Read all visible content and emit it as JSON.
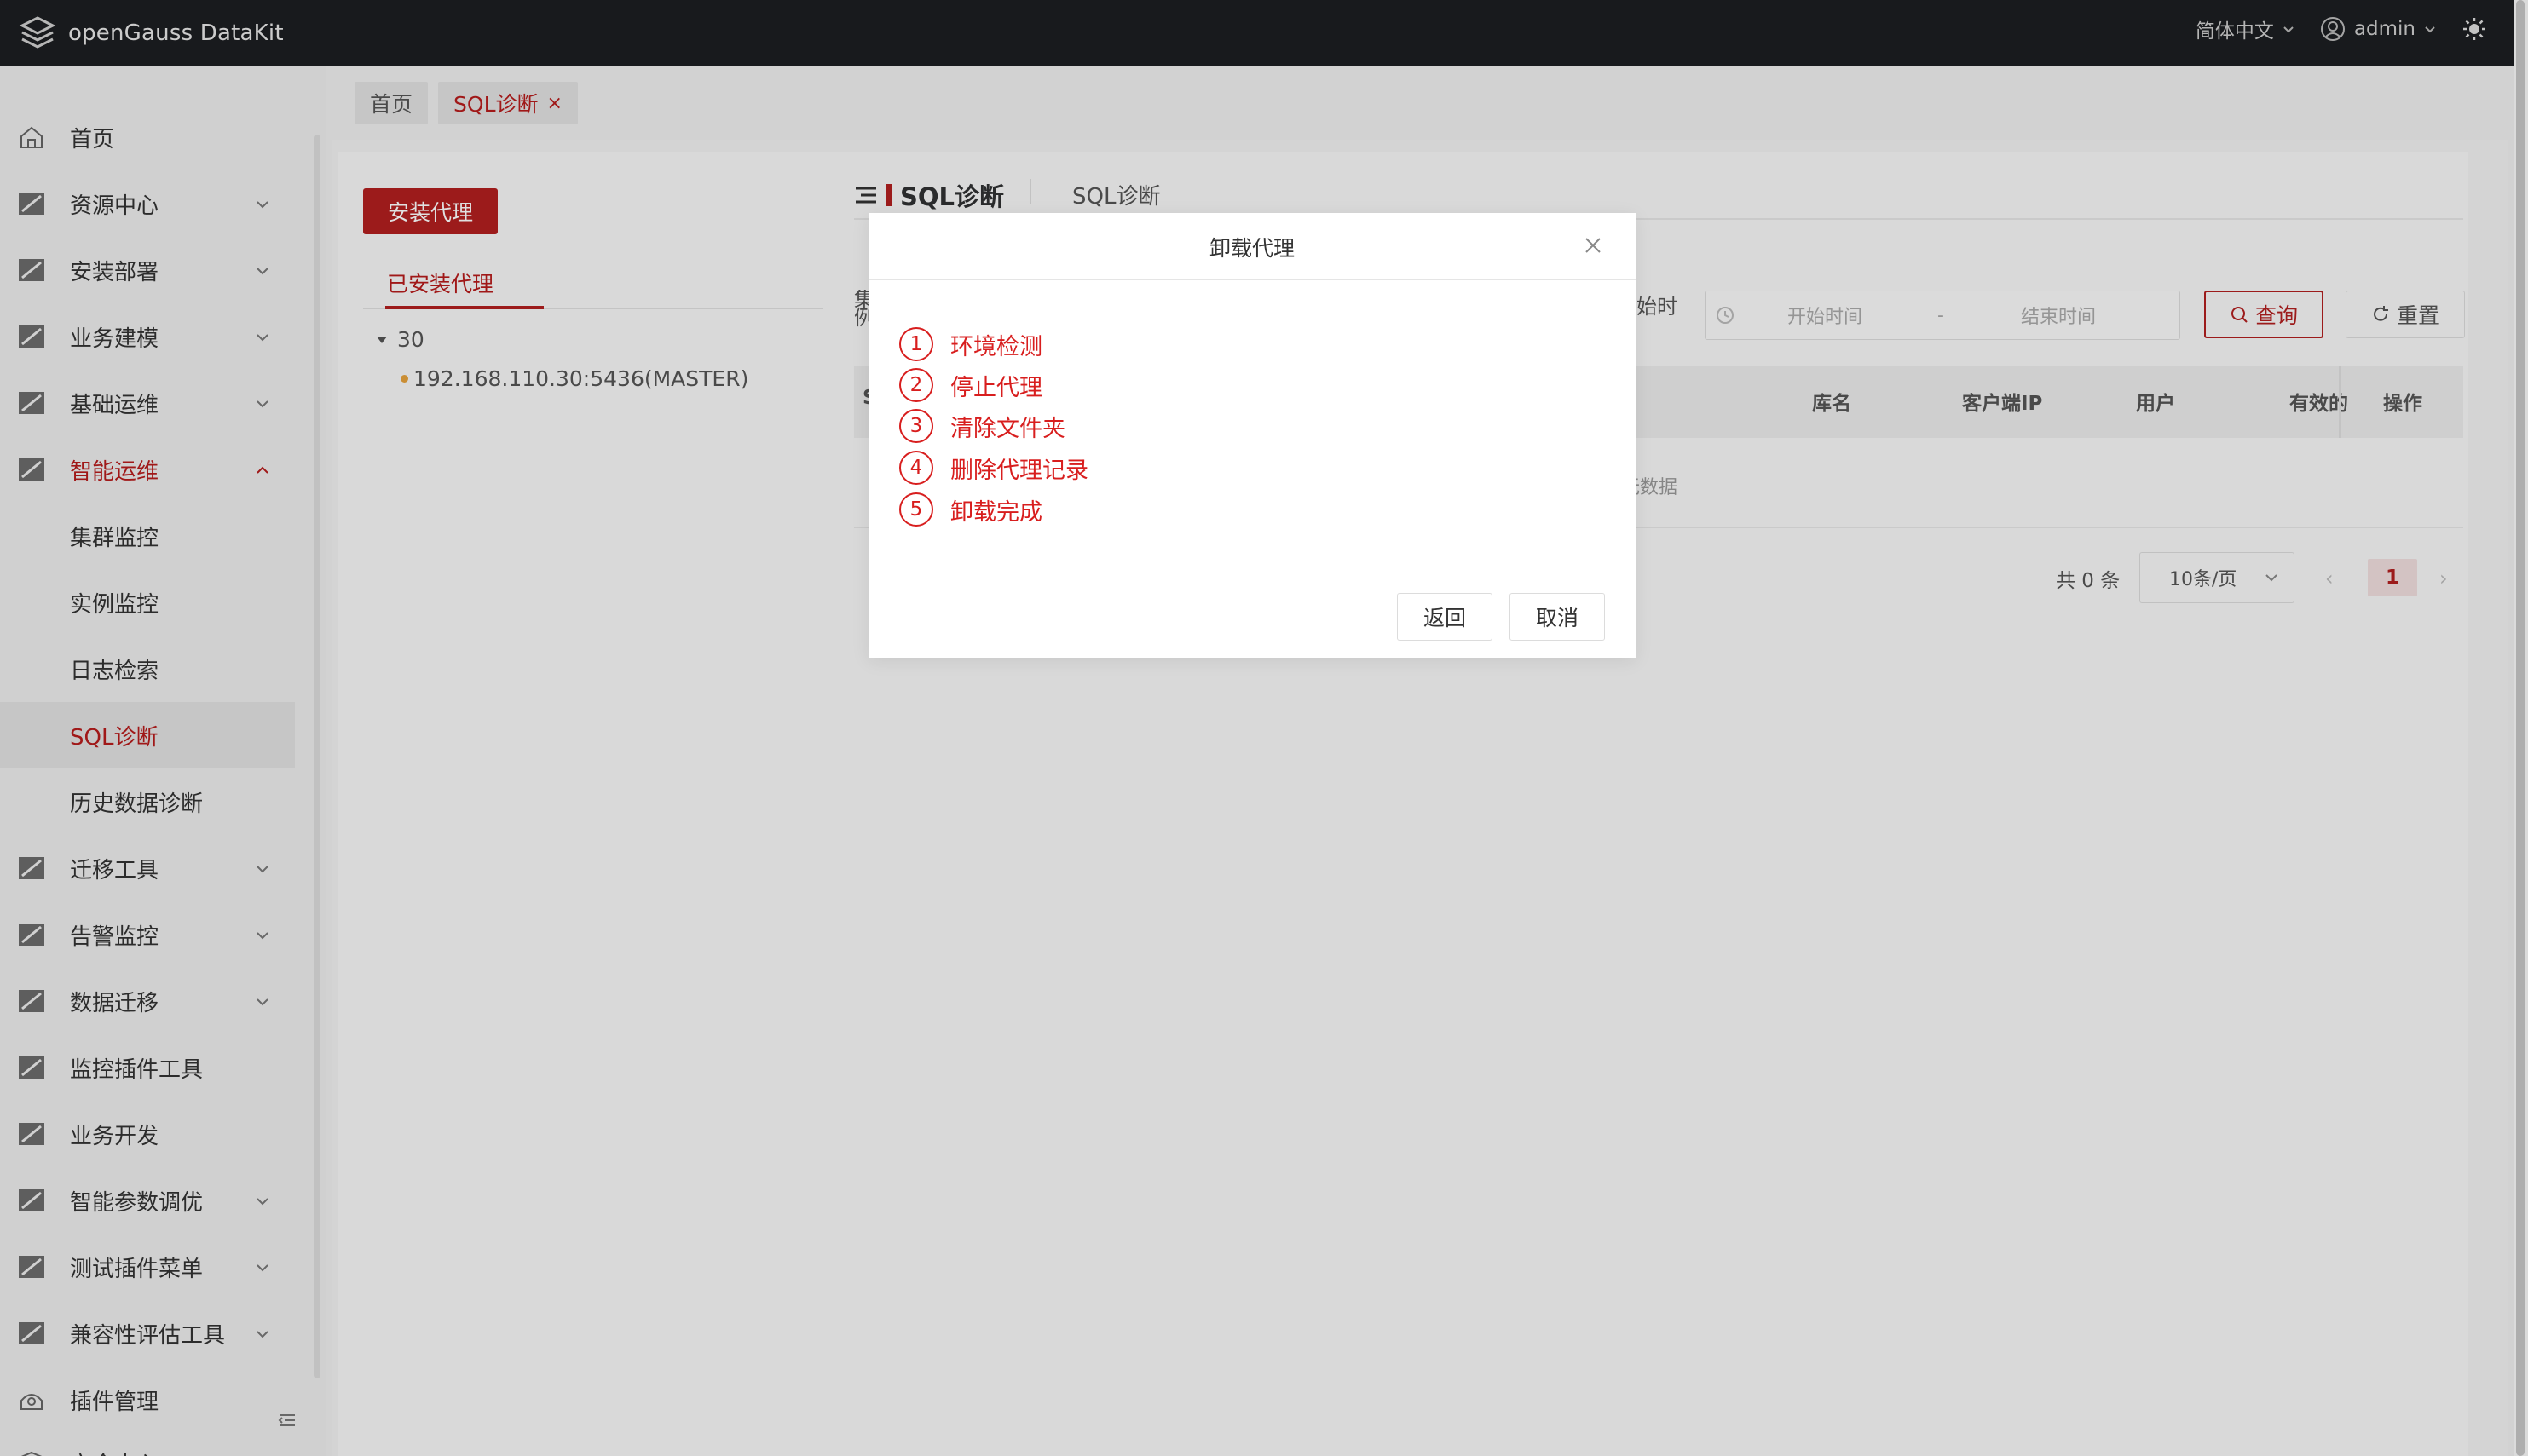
{
  "app": {
    "name": "openGauss DataKit"
  },
  "topbar": {
    "language": "简体中文",
    "user": "admin"
  },
  "sidebar": {
    "items": [
      {
        "label": "首页",
        "icon": "home-icon"
      },
      {
        "label": "资源中心",
        "icon": "folder-icon"
      },
      {
        "label": "安装部署",
        "icon": "folder-icon"
      },
      {
        "label": "业务建模",
        "icon": "folder-icon"
      },
      {
        "label": "基础运维",
        "icon": "folder-icon"
      },
      {
        "label": "智能运维",
        "icon": "folder-icon"
      },
      {
        "label": "集群监控"
      },
      {
        "label": "实例监控"
      },
      {
        "label": "日志检索"
      },
      {
        "label": "SQL诊断"
      },
      {
        "label": "历史数据诊断"
      },
      {
        "label": "迁移工具",
        "icon": "folder-icon"
      },
      {
        "label": "告警监控",
        "icon": "folder-icon"
      },
      {
        "label": "数据迁移",
        "icon": "folder-icon"
      },
      {
        "label": "监控插件工具",
        "icon": "folder-icon"
      },
      {
        "label": "业务开发",
        "icon": "folder-icon"
      },
      {
        "label": "智能参数调优",
        "icon": "folder-icon"
      },
      {
        "label": "测试插件菜单",
        "icon": "folder-icon"
      },
      {
        "label": "兼容性评估工具",
        "icon": "folder-icon"
      },
      {
        "label": "插件管理",
        "icon": "plugin-icon"
      },
      {
        "label": "安全中心",
        "icon": "shield-icon"
      }
    ]
  },
  "tabs": [
    {
      "label": "首页"
    },
    {
      "label": "SQL诊断",
      "close": "×"
    }
  ],
  "agent": {
    "install_button": "安装代理",
    "installed_tab": "已安装代理",
    "tree_root": "30",
    "tree_leaf": "192.168.110.30:5436(MASTER)"
  },
  "section": {
    "title": "SQL诊断",
    "subtitle": "SQL诊断",
    "filter_label_left": "集例",
    "filter_label_right": "始时",
    "date_start_placeholder": "开始时间",
    "date_sep": "-",
    "date_end_placeholder": "结束时间",
    "query_button": "查询",
    "reset_button": "重置"
  },
  "table": {
    "first_col_fragment": "S",
    "columns": [
      "库名",
      "客户端IP",
      "用户",
      "有效的",
      "操作"
    ],
    "empty_text": "无数据"
  },
  "pagination": {
    "total": "共 0 条",
    "page_size": "10条/页",
    "current_page": "1",
    "prev": "‹",
    "next": "›"
  },
  "modal": {
    "title": "卸载代理",
    "steps": [
      {
        "num": "1",
        "label": "环境检测"
      },
      {
        "num": "2",
        "label": "停止代理"
      },
      {
        "num": "3",
        "label": "清除文件夹"
      },
      {
        "num": "4",
        "label": "删除代理记录"
      },
      {
        "num": "5",
        "label": "卸载完成"
      }
    ],
    "back_button": "返回",
    "cancel_button": "取消"
  },
  "colors": {
    "accent": "#b21f1f",
    "step_red": "#d81e1e",
    "topbar": "#1c1e21"
  }
}
